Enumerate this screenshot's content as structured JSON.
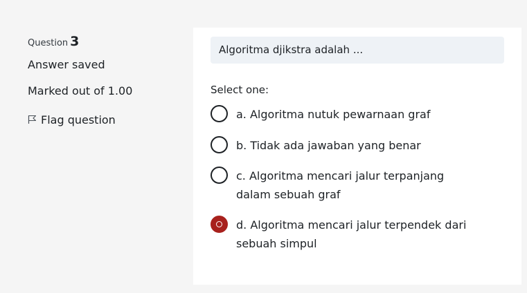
{
  "info": {
    "question_label": "Question",
    "question_number": "3",
    "state": "Answer saved",
    "grade": "Marked out of 1.00",
    "flag_label": "Flag question"
  },
  "question": {
    "text": "Algoritma djikstra adalah ...",
    "prompt": "Select one:",
    "options": [
      {
        "label": "a. Algoritma nutuk pewarnaan graf",
        "checked": false
      },
      {
        "label": "b. Tidak ada jawaban yang benar",
        "checked": false
      },
      {
        "label": "c. Algoritma mencari jalur terpanjang dalam sebuah graf",
        "checked": false
      },
      {
        "label": "d. Algoritma mencari jalur terpendek dari sebuah simpul",
        "checked": true
      }
    ]
  },
  "colors": {
    "accent": "#a8211d",
    "question_bg": "#eef2f6",
    "page_bg": "#f5f5f5"
  },
  "icons": {
    "flag": "flag-icon"
  }
}
